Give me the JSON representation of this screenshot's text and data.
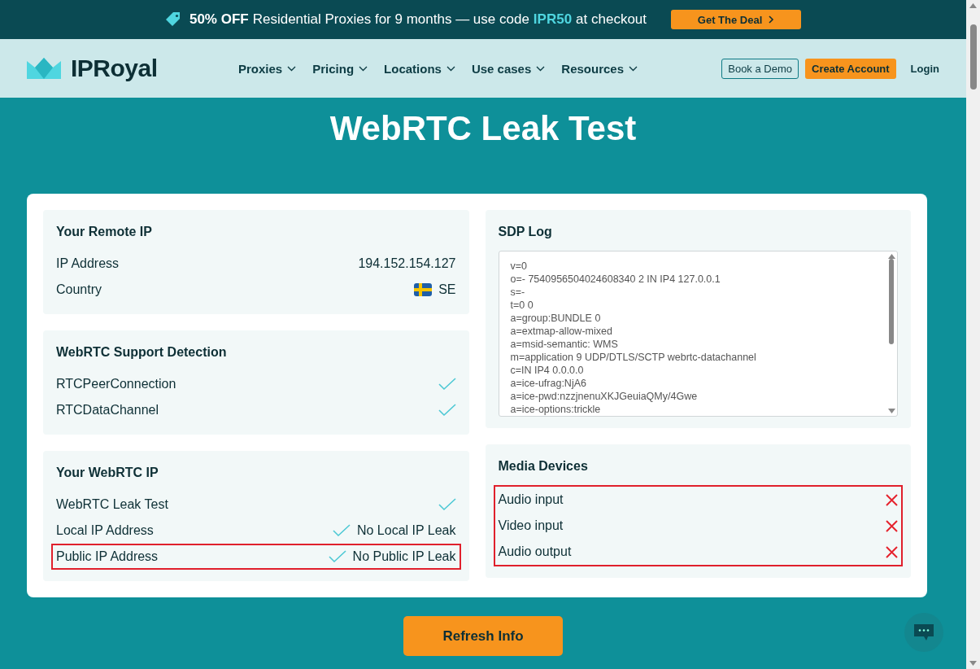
{
  "promo": {
    "parts": [
      {
        "text": "50% OFF",
        "kind": "strong"
      },
      {
        "text": "Residential Proxies for 9 months — use code",
        "kind": "plain"
      },
      {
        "text": "IPR50",
        "kind": "code"
      },
      {
        "text": "at checkout",
        "kind": "plain"
      }
    ],
    "button": "Get The Deal"
  },
  "nav": {
    "logo": "IPRoyal",
    "menu": [
      "Proxies",
      "Pricing",
      "Locations",
      "Use cases",
      "Resources"
    ],
    "demo": "Book a Demo",
    "create": "Create Account",
    "login": "Login"
  },
  "title": "WebRTC Leak Test",
  "remote_ip": {
    "heading": "Your Remote IP",
    "ip_label": "IP Address",
    "ip": "194.152.154.127",
    "country_label": "Country",
    "country": "SE"
  },
  "support": {
    "heading": "WebRTC Support Detection",
    "rows": [
      {
        "label": "RTCPeerConnection",
        "supported": true
      },
      {
        "label": "RTCDataChannel",
        "supported": true
      }
    ]
  },
  "webrtc_ip": {
    "heading": "Your WebRTC IP",
    "rows": [
      {
        "label": "WebRTC Leak Test",
        "passed": true,
        "highlighted": false
      },
      {
        "label": "Local IP Address",
        "passed": true,
        "result": "No Local IP Leak",
        "highlighted": false
      },
      {
        "label": "Public IP Address",
        "passed": true,
        "result": "No Public IP Leak",
        "highlighted": true
      }
    ]
  },
  "sdp_log": {
    "heading": "SDP Log",
    "lines": [
      "v=0",
      "o=- 7540956504024608340 2 IN IP4 127.0.0.1",
      "s=-",
      "t=0 0",
      "a=group:BUNDLE 0",
      "a=extmap-allow-mixed",
      "a=msid-semantic: WMS",
      "m=application 9 UDP/DTLS/SCTP webrtc-datachannel",
      "c=IN IP4 0.0.0.0",
      "a=ice-ufrag:NjA6",
      "a=ice-pwd:nzzjnenuXKJGeuiaQMy/4Gwe",
      "a=ice-options:trickle"
    ]
  },
  "media_devices": {
    "heading": "Media Devices",
    "highlighted": true,
    "rows": [
      {
        "label": "Audio input",
        "available": false
      },
      {
        "label": "Video input",
        "available": false
      },
      {
        "label": "Audio output",
        "available": false
      }
    ]
  },
  "refresh_button": "Refresh Info"
}
